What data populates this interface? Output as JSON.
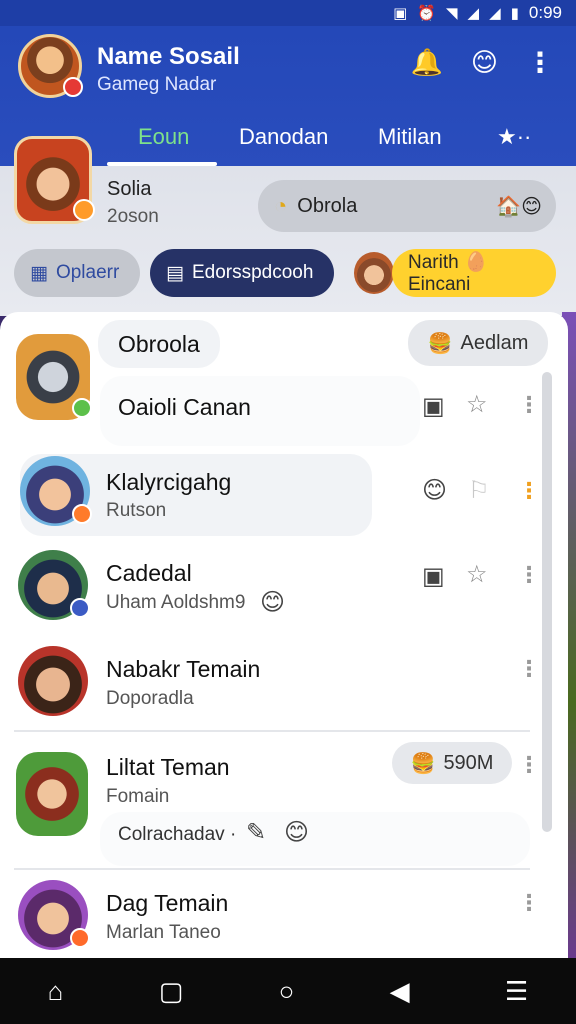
{
  "status_bar": {
    "time": "0:99"
  },
  "header": {
    "title": "Name Sosail",
    "subtitle": "Gameg Nadar",
    "tabs": [
      {
        "label": "Eoun",
        "active": true
      },
      {
        "label": "Danodan",
        "active": false
      },
      {
        "label": "Mitilan",
        "active": false
      }
    ]
  },
  "profile": {
    "name": "Solia",
    "sub": "2oson",
    "pill_label": "Obrola"
  },
  "chips": [
    {
      "label": "Oplaerr"
    },
    {
      "label": "Edorsspdcooh"
    },
    {
      "label": "Narith 🥚 Eincani"
    }
  ],
  "list": {
    "header_bubble": "Obroola",
    "header_action": "Aedlam",
    "rows": [
      {
        "name": "Oaioli Canan",
        "sub": ""
      },
      {
        "name": "Klalyrcigahg",
        "sub": "Rutson"
      },
      {
        "name": "Cadedal",
        "sub": "Uham Aoldshm9"
      },
      {
        "name": "Nabakr Temain",
        "sub": "Doporadla"
      },
      {
        "name": "Liltat Teman",
        "sub": "Fomain",
        "note": "Colrachadav ·",
        "pill": "590M"
      },
      {
        "name": "Dag Temain",
        "sub": "Marlan Taneo"
      }
    ]
  },
  "colors": {
    "header_bg": "#2448b8",
    "active_tab": "#7ee18a",
    "chip_dark": "#263266",
    "chip_yellow": "#ffd12e"
  }
}
